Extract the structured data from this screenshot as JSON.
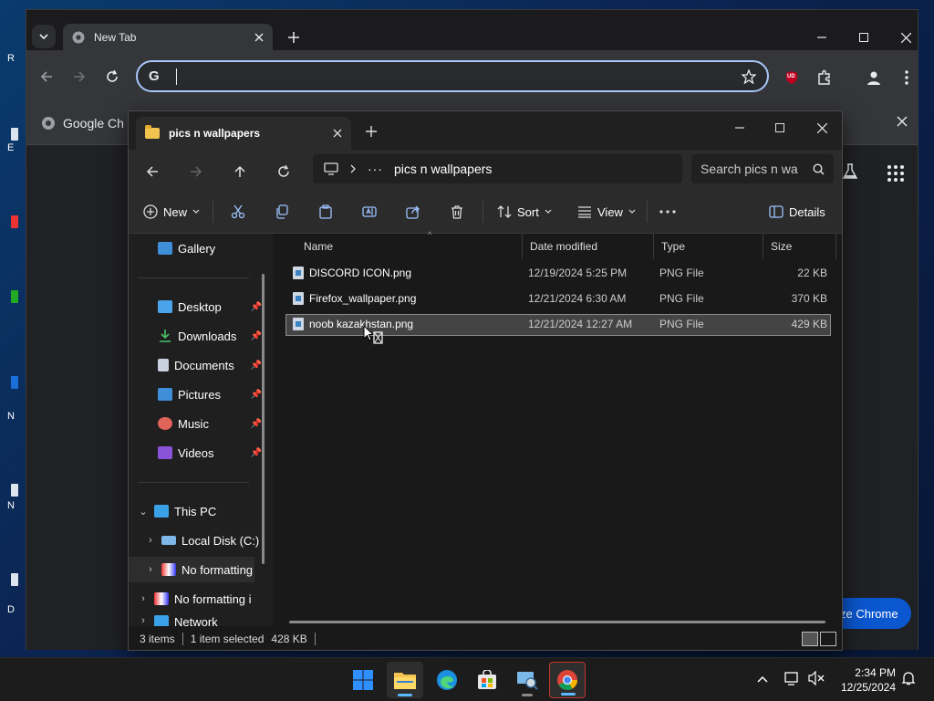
{
  "chrome": {
    "tab_title": "New Tab",
    "bookmark_label": "Google Ch",
    "customize_label": "ze Chrome",
    "ublock_label": "UD"
  },
  "explorer": {
    "tab_title": "pics n wallpapers",
    "breadcrumb_current": "pics n wallpapers",
    "search_placeholder": "Search pics n wa",
    "commands": {
      "new": "New",
      "sort": "Sort",
      "view": "View",
      "details": "Details"
    },
    "nav": {
      "gallery": "Gallery",
      "quick_access": [
        "Desktop",
        "Downloads",
        "Documents",
        "Pictures",
        "Music",
        "Videos"
      ],
      "this_pc": "This PC",
      "local_disk": "Local Disk (C:)",
      "drive2": "No formatting",
      "drive3": "No formatting i",
      "network": "Network"
    },
    "columns": [
      "Name",
      "Date modified",
      "Type",
      "Size"
    ],
    "files": [
      {
        "name": "DISCORD ICON.png",
        "date": "12/19/2024 5:25 PM",
        "type": "PNG File",
        "size": "22 KB"
      },
      {
        "name": "Firefox_wallpaper.png",
        "date": "12/21/2024 6:30 AM",
        "type": "PNG File",
        "size": "370 KB"
      },
      {
        "name": "noob kazakhstan.png",
        "date": "12/21/2024 12:27 AM",
        "type": "PNG File",
        "size": "429 KB"
      }
    ],
    "status": {
      "items": "3 items",
      "selected": "1 item selected",
      "size": "428 KB"
    }
  },
  "desktop": {
    "fragments": [
      "R",
      "E",
      "N",
      "N",
      "D"
    ]
  },
  "taskbar": {
    "time": "2:34 PM",
    "date": "12/25/2024"
  },
  "colors": {
    "accent": "#0b57d0",
    "omnibox_border": "#a8c7fa",
    "folder": "#f2c34e",
    "start_blue": "#2f8fff"
  }
}
